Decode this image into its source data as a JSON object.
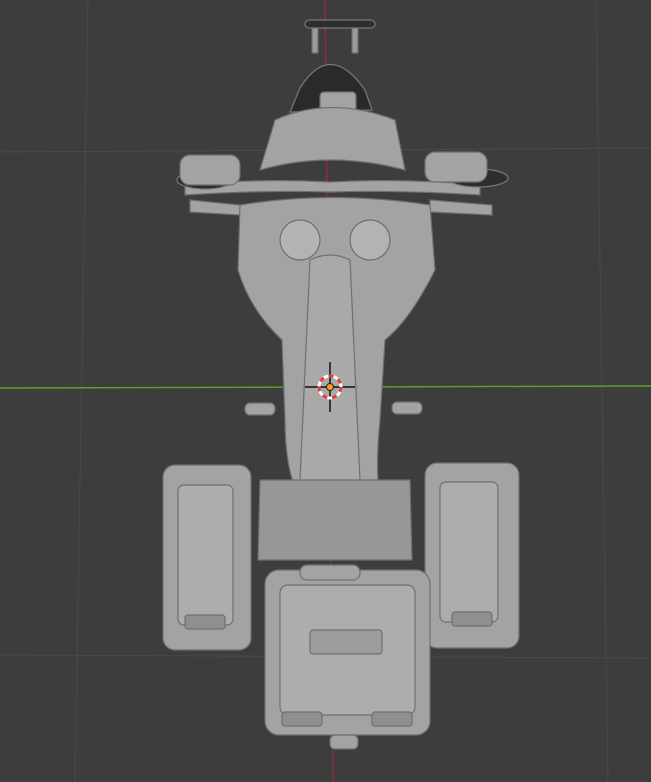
{
  "viewport": {
    "view": "top",
    "background_color": "#3d3d3d",
    "grid_color": "#4a4a4a",
    "x_axis_color": "#5f9e26",
    "z_axis_color": "#8b2f3a",
    "model_color": "#a3a3a3",
    "model_shadow_color": "#6f6f6f",
    "cursor_color_a": "#e53b3b",
    "cursor_color_b": "#ffffff",
    "origin_color": "#ff9a1a",
    "cursor_icon": "3d-cursor-icon",
    "model_name": "motorcycle-with-panniers"
  }
}
